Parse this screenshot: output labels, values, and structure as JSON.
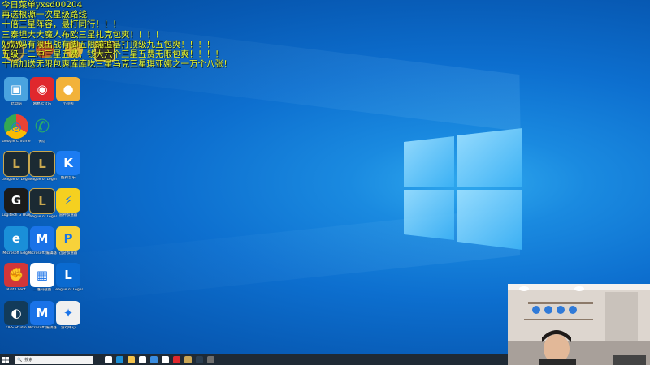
{
  "overlay": {
    "lines": [
      "今日菜单yxsd00204",
      "再送根源一次星级路线",
      "十倍三星阵容，最打同行！！！",
      "三泰坦大大魔人布欧三星扎克包爽！！！！",
      "奶奶妈有限出战有脚五限蹦追基打顶级九五包爽！！！！",
      "五级一二冲三星五费，钱大六个三星五费无限包爽！！！！",
      "十倍加送无限包爽库库吃三星马克三星琪亚娜之一万个八张！"
    ]
  },
  "desktop_icons": [
    {
      "label": "此电脑",
      "icon": "pc-icon",
      "color": "#4aa3df"
    },
    {
      "label": "网易云音乐",
      "icon": "netease-music-icon",
      "color": "#e0282d"
    },
    {
      "label": "小浣熊",
      "icon": "raccoon-icon",
      "color": "#f2b23a"
    },
    {
      "label": "Google Chrome",
      "icon": "chrome-icon",
      "color": "#ffffff"
    },
    {
      "label": "微信",
      "icon": "wechat-icon",
      "color": "#ffffff"
    },
    {
      "label": "League of Legends",
      "icon": "lol-icon",
      "color": "#1b2a33"
    },
    {
      "label": "League of Legends",
      "icon": "lol-icon",
      "color": "#1b2a33"
    },
    {
      "label": "酷狗音乐",
      "icon": "kugou-icon",
      "color": "#1c7cf2"
    },
    {
      "label": "Logitech G HUB",
      "icon": "logitech-g-icon",
      "color": "#1b1b1b"
    },
    {
      "label": "League of Legends",
      "icon": "lol-icon",
      "color": "#1b2a33"
    },
    {
      "label": "雷神加速器",
      "icon": "lightning-icon",
      "color": "#f5d020"
    },
    {
      "label": "Microsoft Edge",
      "icon": "edge-icon",
      "color": "#1a8fd8"
    },
    {
      "label": "Microsoft 编辑器",
      "icon": "microsoft-m-icon",
      "color": "#1a73e8"
    },
    {
      "label": "迅游加速器",
      "icon": "accelerator-icon",
      "color": "#f7d23a"
    },
    {
      "label": "Riot Client",
      "icon": "riot-fist-icon",
      "color": "#d13639"
    },
    {
      "label": "二维码截图",
      "icon": "qr-code-icon",
      "color": "#ffffff"
    },
    {
      "label": "League of Legends",
      "icon": "lol-small-icon",
      "color": "#0a6ad0"
    },
    {
      "label": "OBS Studio",
      "icon": "obs-icon",
      "color": "#123b5a"
    },
    {
      "label": "Microsoft 编辑器",
      "icon": "microsoft-m-icon",
      "color": "#1a73e8"
    },
    {
      "label": "游戏中心",
      "icon": "game-center-icon",
      "color": "#f0f0f0"
    }
  ],
  "taskbar": {
    "search_placeholder": "搜索",
    "apps": [
      {
        "icon": "task-view-icon",
        "color": "#ffffff"
      },
      {
        "icon": "edge-taskbar-icon",
        "color": "#1a8fd8"
      },
      {
        "icon": "file-explorer-icon",
        "color": "#f4c34d"
      },
      {
        "icon": "store-icon",
        "color": "#ffffff"
      },
      {
        "icon": "mail-icon",
        "color": "#3b8de0"
      },
      {
        "icon": "chrome-taskbar-icon",
        "color": "#ffffff"
      },
      {
        "icon": "netease-taskbar-icon",
        "color": "#e0282d"
      },
      {
        "icon": "lol-taskbar-icon",
        "color": "#caa655"
      },
      {
        "icon": "app-taskbar-icon",
        "color": "#2c3e50"
      },
      {
        "icon": "obs-taskbar-icon",
        "color": "#6e6e6e"
      }
    ]
  },
  "colors": {
    "overlay_text": "#f2ff2e",
    "taskbar": "#1f2a35",
    "wallpaper_accent": "#2fa8ee"
  }
}
